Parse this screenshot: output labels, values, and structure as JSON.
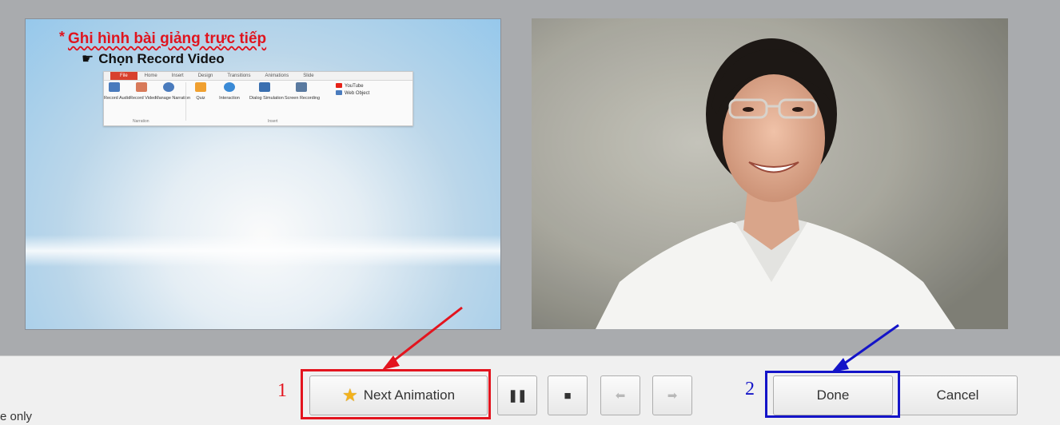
{
  "slide": {
    "title_bullet": "*",
    "title": "Ghi hình bài giảng trực tiếp",
    "bullet_icon": "pointing-hand-icon",
    "bullet_text": "Chọn Record Video",
    "ribbon": {
      "tabs": [
        "File",
        "Home",
        "Insert",
        "Design",
        "Transitions",
        "Animations",
        "Slide"
      ],
      "buttons": [
        {
          "label": "Record Audio",
          "icon": "microphone-icon",
          "color": "#4a7bbd"
        },
        {
          "label": "Record Video",
          "icon": "camera-icon",
          "color": "#d87a5a"
        },
        {
          "label": "Manage Narration",
          "icon": "clock-icon",
          "color": "#4a7bbd"
        },
        {
          "label": "Quiz",
          "icon": "quiz-icon",
          "color": "#f0a030"
        },
        {
          "label": "Interaction",
          "icon": "interaction-icon",
          "color": "#3a8ad6"
        },
        {
          "label": "Dialog Simulation",
          "icon": "dialog-icon",
          "color": "#3a6fb0"
        },
        {
          "label": "Screen Recording",
          "icon": "screen-icon",
          "color": "#5a7aa0"
        }
      ],
      "groups": [
        "Narration",
        "Insert"
      ],
      "extras": [
        "YouTube",
        "Web Object"
      ]
    }
  },
  "webcam": {
    "content": "presenter-webcam-feed"
  },
  "controls": {
    "next_animation_label": "Next Animation",
    "next_animation_icon": "star-icon",
    "pause_icon": "pause-icon",
    "stop_icon": "stop-icon",
    "prev_icon": "arrow-left-icon",
    "fwd_icon": "arrow-right-icon",
    "done_label": "Done",
    "cancel_label": "Cancel"
  },
  "annotations": {
    "step1": "1",
    "step2": "2",
    "red": "#e3141e",
    "blue": "#1414c8"
  },
  "footnote": "e only"
}
